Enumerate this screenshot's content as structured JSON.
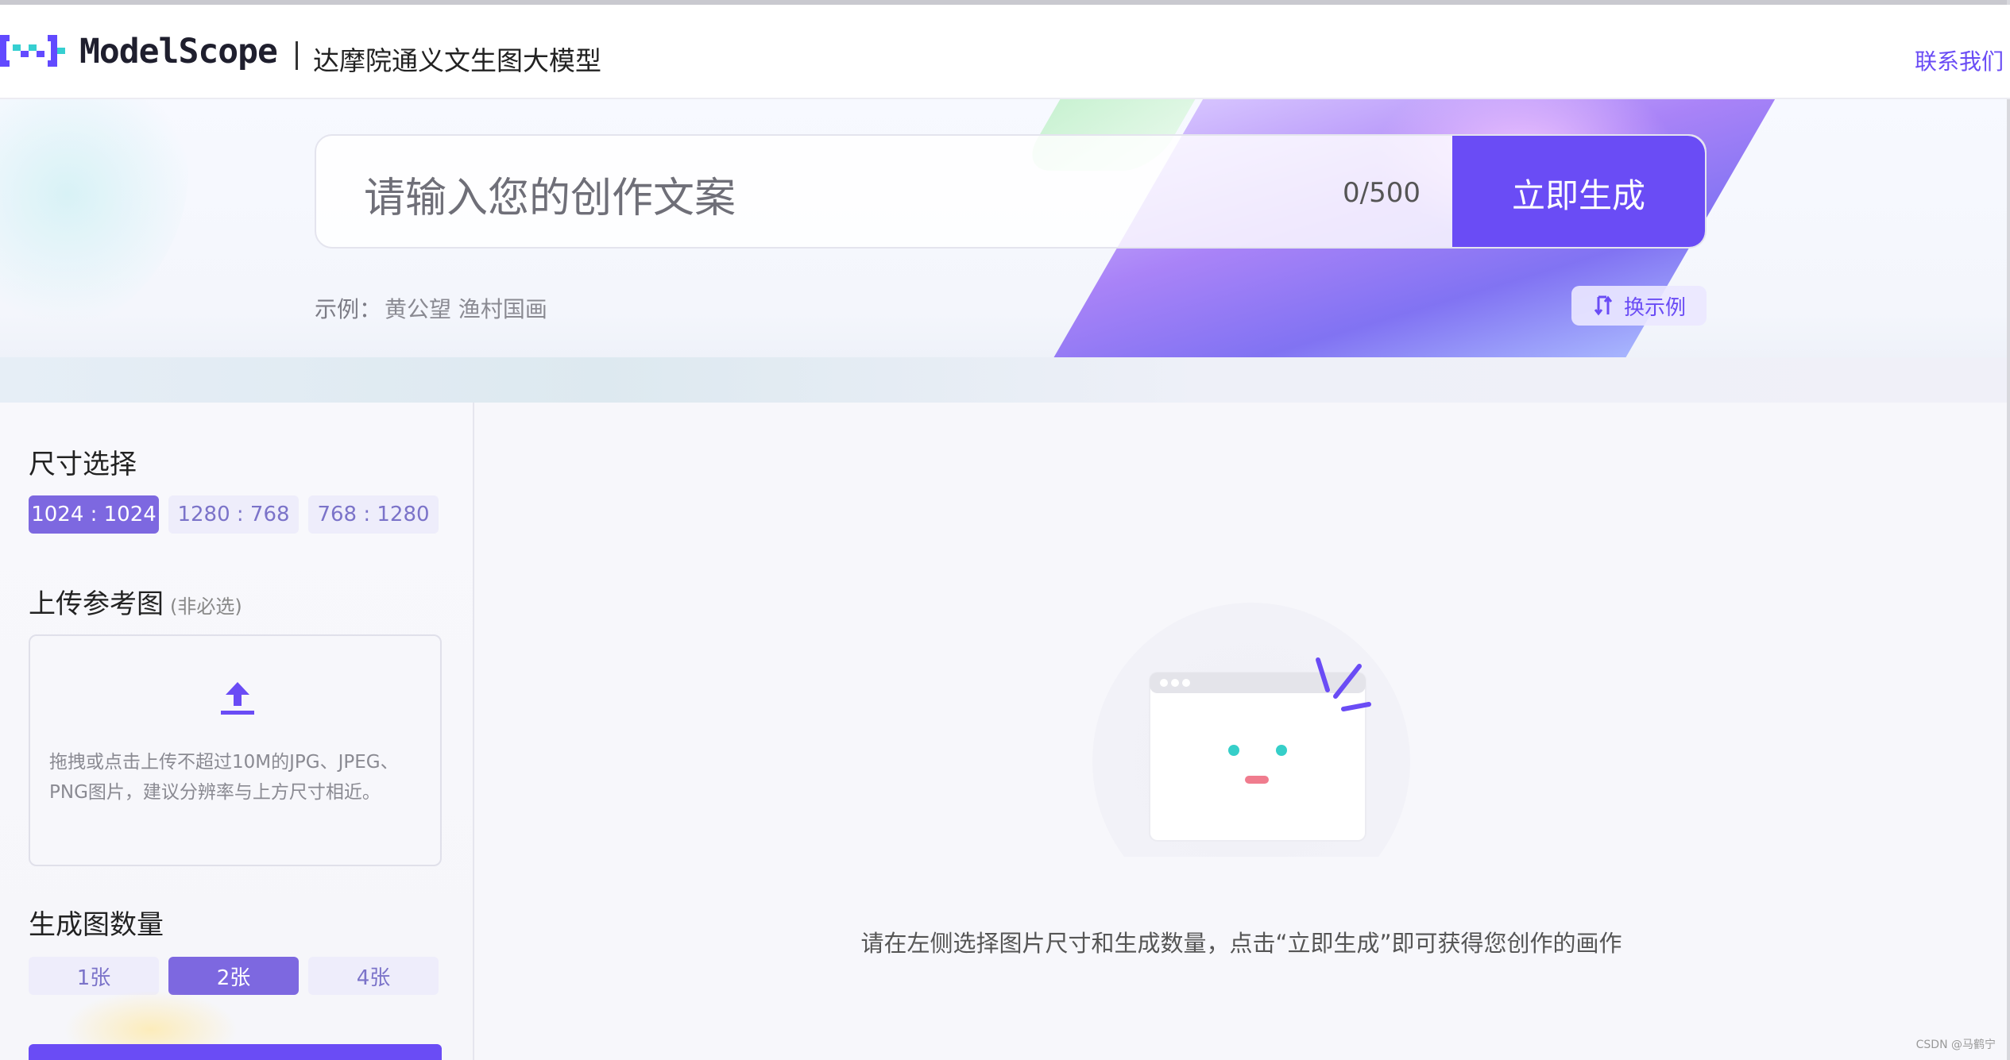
{
  "header": {
    "logo_text": "ModelScope",
    "title": "达摩院通义文生图大模型",
    "contact_link": "联系我们"
  },
  "hero": {
    "search_placeholder": "请输入您的创作文案",
    "char_count": "0/500",
    "generate_button": "立即生成",
    "example_label": "示例：",
    "example_value": "黄公望 渔村国画",
    "swap_button": "换示例"
  },
  "left_panel": {
    "size_title": "尺寸选择",
    "sizes": [
      "1024 : 1024",
      "1280 : 768",
      "768 : 1280"
    ],
    "selected_size": "1024 : 1024",
    "upload_title": "上传参考图",
    "upload_hint": "(非必选)",
    "upload_text": "拖拽或点击上传不超过10M的JPG、JPEG、PNG图片，建议分辨率与上方尺寸相近。",
    "count_title": "生成图数量",
    "counts": [
      "1张",
      "2张",
      "4张"
    ],
    "selected_count": "2张"
  },
  "main": {
    "empty_text": "请在左侧选择图片尺寸和生成数量，点击“立即生成”即可获得您创作的画作"
  },
  "watermark": "CSDN @马鹤宁",
  "colors": {
    "accent": "#6a4cf5",
    "pill_active": "#7d68e0",
    "pill_bg": "#eeedfb"
  }
}
